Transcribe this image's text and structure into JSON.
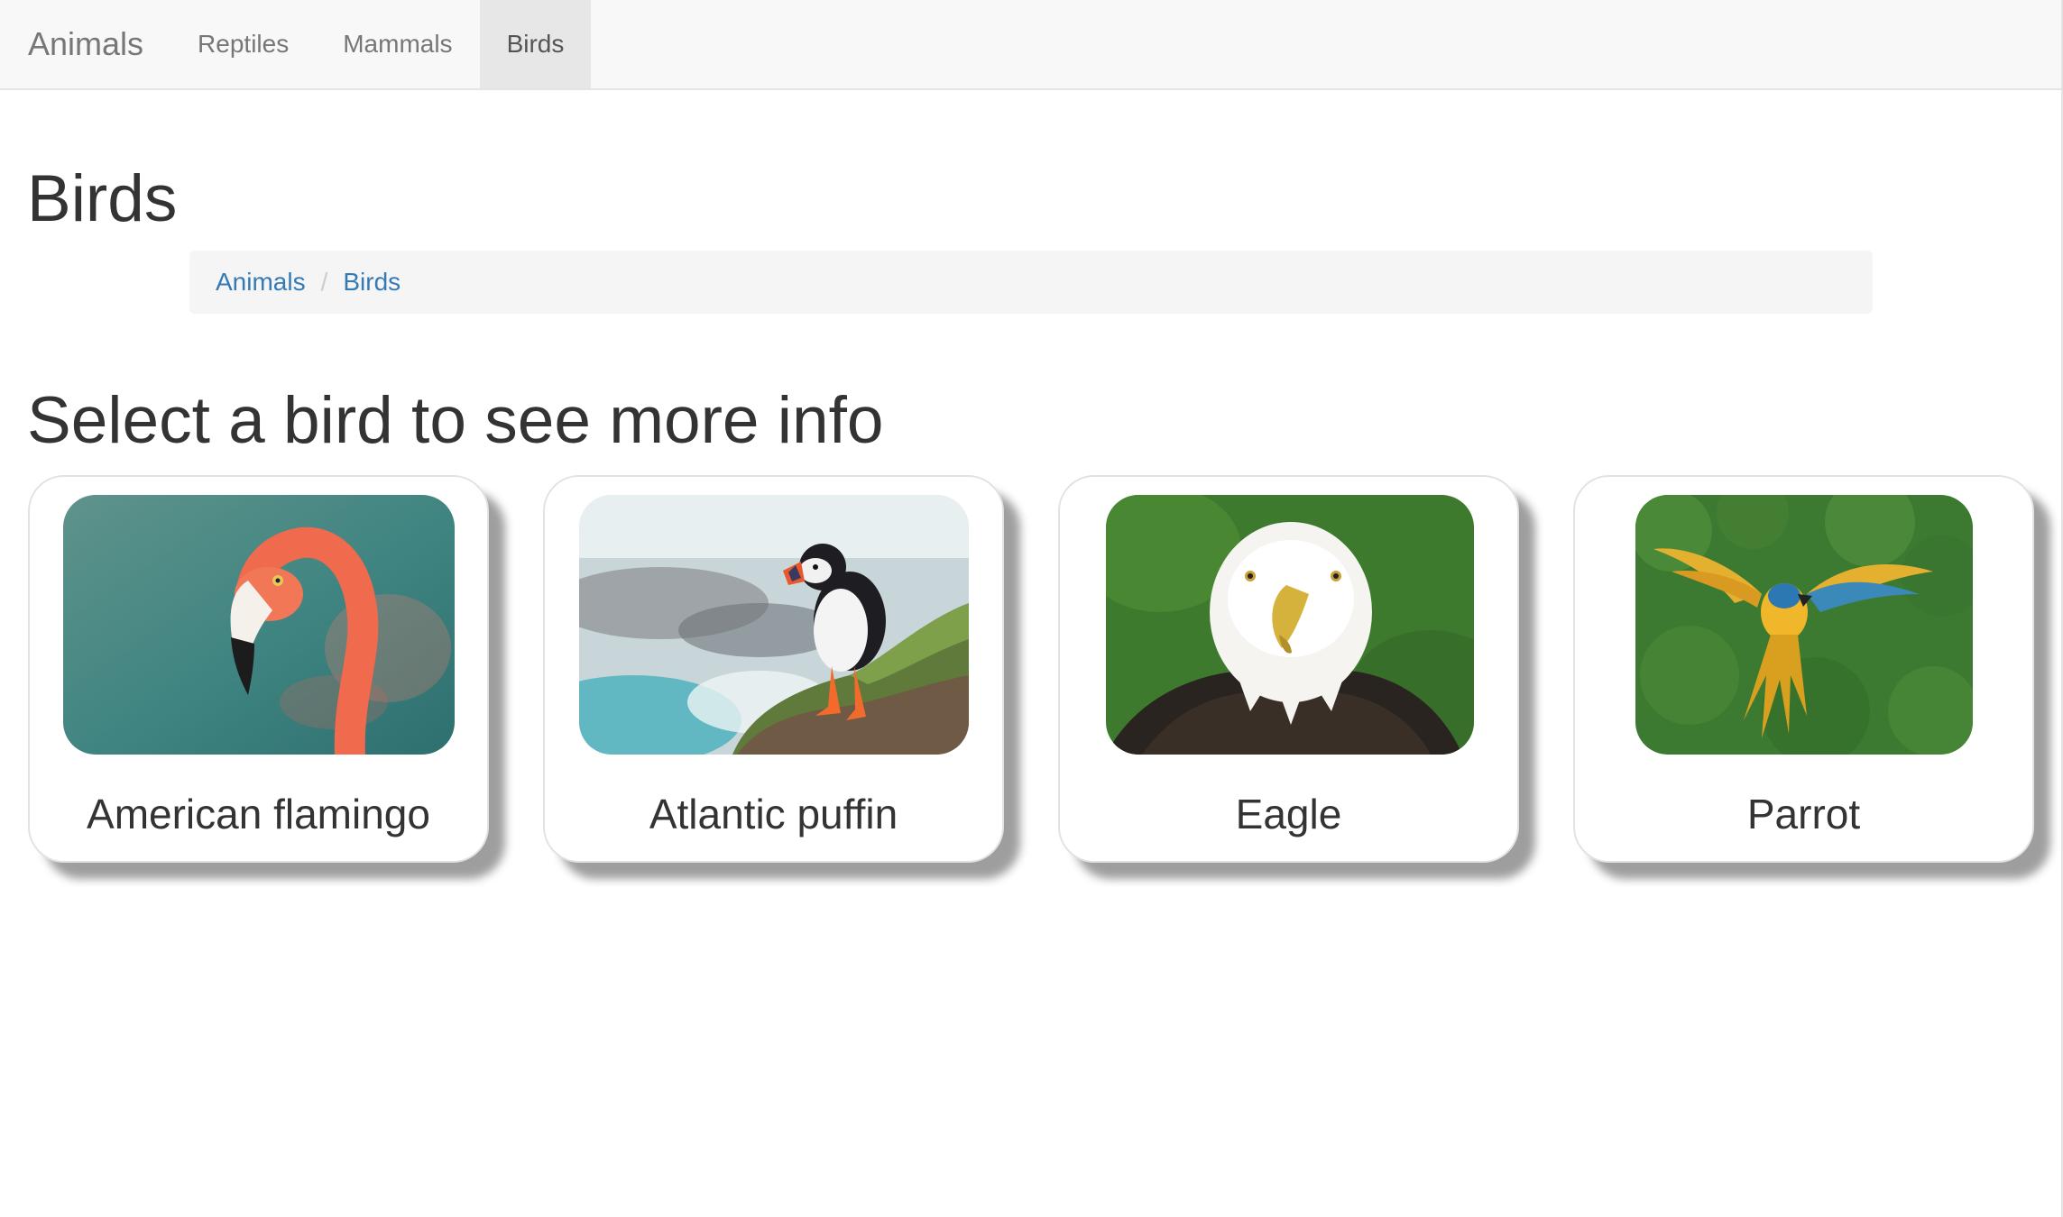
{
  "navbar": {
    "brand": "Animals",
    "items": [
      {
        "label": "Reptiles",
        "active": false
      },
      {
        "label": "Mammals",
        "active": false
      },
      {
        "label": "Birds",
        "active": true
      }
    ]
  },
  "page": {
    "title": "Birds",
    "subtitle": "Select a bird to see more info"
  },
  "breadcrumb": {
    "items": [
      "Animals",
      "Birds"
    ],
    "separator": "/"
  },
  "cards": [
    {
      "name": "American flamingo",
      "image": "flamingo-photo"
    },
    {
      "name": "Atlantic puffin",
      "image": "puffin-photo"
    },
    {
      "name": "Eagle",
      "image": "eagle-photo"
    },
    {
      "name": "Parrot",
      "image": "parrot-photo"
    }
  ],
  "colors": {
    "link": "#337ab7",
    "navbar_bg": "#f8f8f8",
    "nav_active_bg": "#e7e7e7",
    "text": "#333333"
  }
}
